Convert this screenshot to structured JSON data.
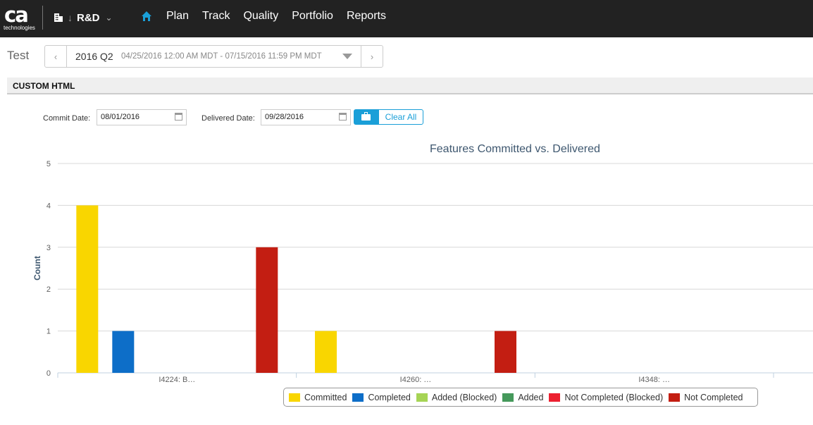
{
  "header": {
    "logo_text": "ca",
    "logo_subtext": "technologies",
    "workspace": "R&D",
    "nav": [
      "Plan",
      "Track",
      "Quality",
      "Portfolio",
      "Reports"
    ]
  },
  "timebox": {
    "label": "Test",
    "name": "2016 Q2",
    "range": "04/25/2016 12:00 AM MDT - 07/15/2016 11:59 PM MDT"
  },
  "section": {
    "title": "CUSTOM HTML"
  },
  "filters": {
    "commit_label": "Commit Date:",
    "commit_value": "08/01/2016",
    "delivered_label": "Delivered Date:",
    "delivered_value": "09/28/2016",
    "clear_label": "Clear All"
  },
  "colors": {
    "committed": "#f9d600",
    "completed": "#0d6ec8",
    "added_blocked": "#a6d455",
    "added": "#45995b",
    "not_completed_blocked": "#ec2030",
    "not_completed": "#c31e12",
    "axis_title": "#3e576f",
    "accent": "#1a9fd8"
  },
  "chart_data": {
    "type": "bar",
    "title": "Features Committed vs. Delivered",
    "ylabel": "Count",
    "ylim": [
      0,
      5
    ],
    "yticks": [
      0,
      1,
      2,
      3,
      4,
      5
    ],
    "categories": [
      "I4224: B…",
      "I4260: …",
      "I4348: …"
    ],
    "series": [
      {
        "name": "Committed",
        "color_key": "committed",
        "values": [
          4,
          1,
          0
        ]
      },
      {
        "name": "Completed",
        "color_key": "completed",
        "values": [
          1,
          0,
          0
        ]
      },
      {
        "name": "Added (Blocked)",
        "color_key": "added_blocked",
        "values": [
          0,
          0,
          0
        ]
      },
      {
        "name": "Added",
        "color_key": "added",
        "values": [
          0,
          0,
          0
        ]
      },
      {
        "name": "Not Completed (Blocked)",
        "color_key": "not_completed_blocked",
        "values": [
          0,
          0,
          0
        ]
      },
      {
        "name": "Not Completed",
        "color_key": "not_completed",
        "values": [
          3,
          1,
          0
        ]
      }
    ],
    "legend_position": "bottom",
    "grid": true
  }
}
